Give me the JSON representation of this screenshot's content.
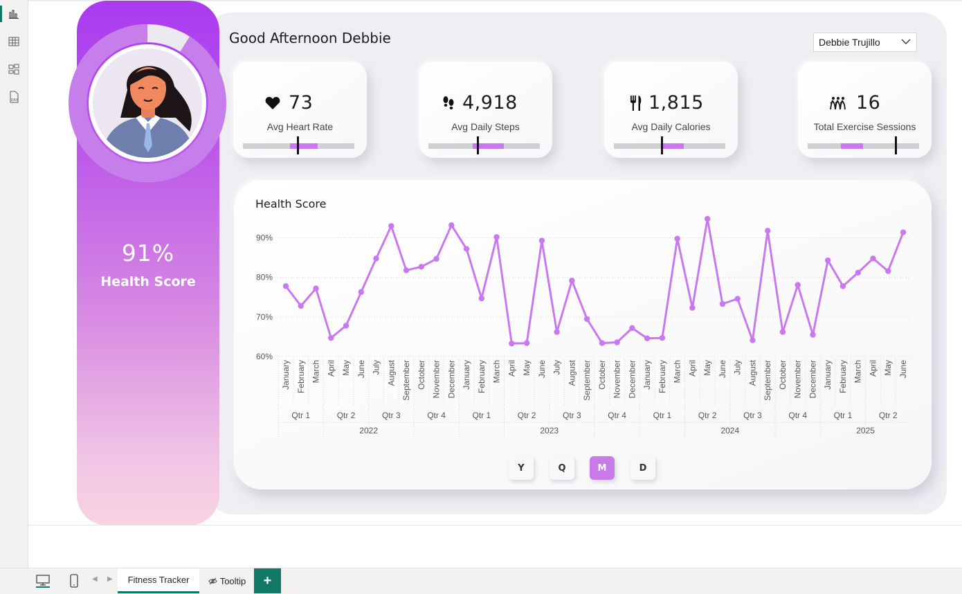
{
  "greeting": "Good Afternoon Debbie",
  "user_slicer": {
    "selected": "Debbie Trujillo"
  },
  "profile": {
    "score_value": "91%",
    "score_label": "Health Score",
    "score_fraction": 0.91
  },
  "kpis": [
    {
      "icon": "heart-icon",
      "value": "73",
      "label": "Avg Heart Rate",
      "band": [
        0.42,
        0.67
      ],
      "marker": 0.49
    },
    {
      "icon": "footsteps-icon",
      "value": "4,918",
      "label": "Avg Daily Steps",
      "band": [
        0.4,
        0.68
      ],
      "marker": 0.44
    },
    {
      "icon": "fork-knife-icon",
      "value": "1,815",
      "label": "Avg Daily Calories",
      "band": [
        0.44,
        0.63
      ],
      "marker": 0.43
    },
    {
      "icon": "group-walking-icon",
      "value": "16",
      "label": "Total Exercise Sessions",
      "band": [
        0.3,
        0.5
      ],
      "marker": 0.79
    }
  ],
  "chart_data": {
    "type": "line",
    "title": "Health Score",
    "color": "#c879ef",
    "ylim": [
      60,
      95
    ],
    "yticks": [
      "60%",
      "70%",
      "80%",
      "90%"
    ],
    "ytick_values": [
      60,
      70,
      80,
      90
    ],
    "months": [
      "January",
      "February",
      "March",
      "April",
      "May",
      "June",
      "July",
      "August",
      "September",
      "October",
      "November",
      "December",
      "January",
      "February",
      "March",
      "April",
      "May",
      "June",
      "July",
      "August",
      "September",
      "October",
      "November",
      "December",
      "January",
      "February",
      "March",
      "April",
      "May",
      "June",
      "July",
      "August",
      "September",
      "October",
      "November",
      "December",
      "January",
      "February",
      "March",
      "April",
      "May",
      "June"
    ],
    "values": [
      77.8,
      72.8,
      77.2,
      64.7,
      67.8,
      76.3,
      84.8,
      93.0,
      81.8,
      82.7,
      84.7,
      93.2,
      87.2,
      74.7,
      90.2,
      63.3,
      63.4,
      89.3,
      66.2,
      79.2,
      69.5,
      63.4,
      63.6,
      67.2,
      64.6,
      64.7,
      89.8,
      72.3,
      94.8,
      73.3,
      74.6,
      64.1,
      91.8,
      66.2,
      78.1,
      65.5,
      84.3,
      77.8,
      81.2,
      84.8,
      81.6,
      91.4
    ],
    "quarters": [
      "Qtr 1",
      "Qtr 2",
      "Qtr 3",
      "Qtr 4",
      "Qtr 1",
      "Qtr 2",
      "Qtr 3",
      "Qtr 4",
      "Qtr 1",
      "Qtr 2",
      "Qtr 3",
      "Qtr 4",
      "Qtr 1",
      "Qtr 2"
    ],
    "years": [
      "2022",
      "2023",
      "2024",
      "2025"
    ],
    "year_month_counts": [
      12,
      12,
      12,
      6
    ],
    "grid": true
  },
  "granularity": {
    "buttons": [
      "Y",
      "Q",
      "M",
      "D"
    ],
    "active": "M"
  },
  "pages": {
    "tab1": "Fitness Tracker",
    "tab2": "Tooltip",
    "add": "+"
  }
}
